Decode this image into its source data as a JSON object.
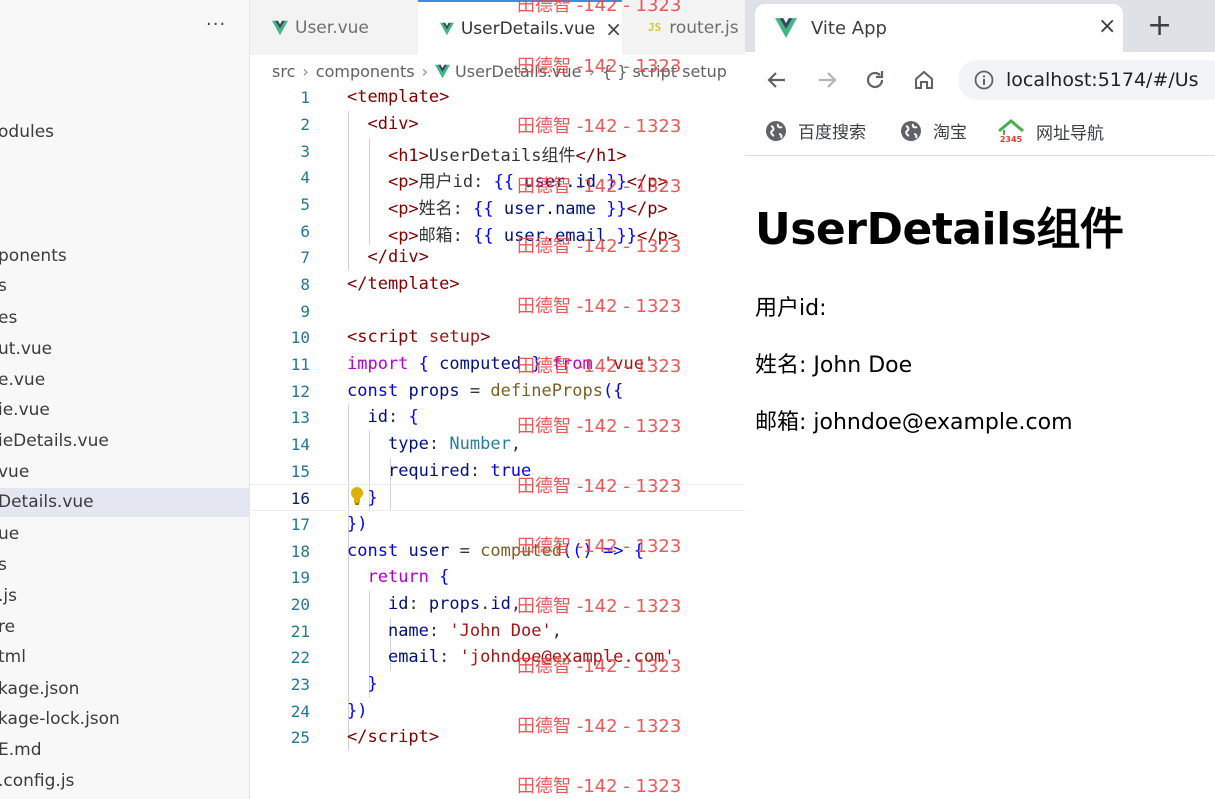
{
  "explorer": {
    "more_label": "···",
    "items": [
      {
        "label": "odules"
      },
      {
        "label": "ponents"
      },
      {
        "label": "s"
      },
      {
        "label": "es"
      },
      {
        "label": "ut.vue"
      },
      {
        "label": "e.vue"
      },
      {
        "label": "ie.vue"
      },
      {
        "label": "ieDetails.vue"
      },
      {
        "label": "vue"
      },
      {
        "label": "Details.vue",
        "active": true
      },
      {
        "label": "ue"
      },
      {
        "label": "s"
      },
      {
        "label": ".js"
      },
      {
        "label": "re"
      },
      {
        "label": "tml"
      },
      {
        "label": "kage.json"
      },
      {
        "label": "kage-lock.json"
      },
      {
        "label": "E.md"
      },
      {
        "label": ".config.js"
      }
    ]
  },
  "editor": {
    "tabs": [
      {
        "label": "User.vue",
        "icon": "vue-icon"
      },
      {
        "label": "UserDetails.vue",
        "icon": "vue-icon",
        "active": true,
        "close": "×"
      },
      {
        "label": "router.js",
        "icon_text": "JS"
      }
    ],
    "breadcrumb": [
      "src",
      "components",
      "UserDetails.vue",
      "{ } script setup"
    ],
    "current_line": 16,
    "line_numbers": [
      "1",
      "2",
      "3",
      "4",
      "5",
      "6",
      "7",
      "8",
      "9",
      "10",
      "11",
      "12",
      "13",
      "14",
      "15",
      "16",
      "17",
      "18",
      "19",
      "20",
      "21",
      "22",
      "23",
      "24",
      "25"
    ]
  },
  "browser": {
    "tab_title": "Vite App",
    "tab_close": "×",
    "new_tab": "+",
    "url": "localhost:5174/#/Us",
    "bookmarks": [
      "百度搜索",
      "淘宝",
      "网址导航"
    ],
    "page": {
      "heading": "UserDetails组件",
      "rows": [
        "用户id:",
        "姓名: John Doe",
        "邮箱: johndoe@example.com"
      ]
    }
  },
  "watermark": "田德智 -142 - 1323",
  "colors": {
    "accent": "#3c8dde",
    "vue_green": "#41b883",
    "vue_dark": "#35495e",
    "watermark": "#e84646"
  }
}
